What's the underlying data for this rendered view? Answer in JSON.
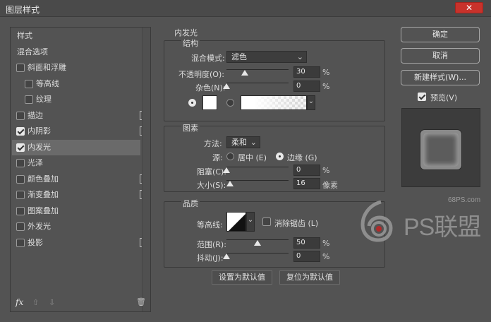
{
  "window": {
    "title": "图层样式",
    "close_glyph": "✕"
  },
  "sidebar": {
    "items": [
      {
        "label": "样式",
        "checkbox": false,
        "checked": false,
        "plus": false,
        "indent": 0,
        "selected": false
      },
      {
        "label": "混合选项",
        "checkbox": false,
        "checked": false,
        "plus": false,
        "indent": 0,
        "selected": false
      },
      {
        "label": "斜面和浮雕",
        "checkbox": true,
        "checked": false,
        "plus": false,
        "indent": 0,
        "selected": false
      },
      {
        "label": "等高线",
        "checkbox": true,
        "checked": false,
        "plus": false,
        "indent": 1,
        "selected": false
      },
      {
        "label": "纹理",
        "checkbox": true,
        "checked": false,
        "plus": false,
        "indent": 1,
        "selected": false
      },
      {
        "label": "描边",
        "checkbox": true,
        "checked": false,
        "plus": true,
        "indent": 0,
        "selected": false
      },
      {
        "label": "内阴影",
        "checkbox": true,
        "checked": true,
        "plus": true,
        "indent": 0,
        "selected": false
      },
      {
        "label": "内发光",
        "checkbox": true,
        "checked": true,
        "plus": false,
        "indent": 0,
        "selected": true
      },
      {
        "label": "光泽",
        "checkbox": true,
        "checked": false,
        "plus": false,
        "indent": 0,
        "selected": false
      },
      {
        "label": "颜色叠加",
        "checkbox": true,
        "checked": false,
        "plus": true,
        "indent": 0,
        "selected": false
      },
      {
        "label": "渐变叠加",
        "checkbox": true,
        "checked": false,
        "plus": true,
        "indent": 0,
        "selected": false
      },
      {
        "label": "图案叠加",
        "checkbox": true,
        "checked": false,
        "plus": false,
        "indent": 0,
        "selected": false
      },
      {
        "label": "外发光",
        "checkbox": true,
        "checked": false,
        "plus": false,
        "indent": 0,
        "selected": false
      },
      {
        "label": "投影",
        "checkbox": true,
        "checked": false,
        "plus": true,
        "indent": 0,
        "selected": false
      }
    ],
    "plus_glyph": "+",
    "fx_label": "fx",
    "up_glyph": "⇧",
    "down_glyph": "⇩",
    "trash_glyph": "🗑"
  },
  "inner_glow": {
    "title": "内发光",
    "structure": {
      "title": "结构",
      "blend_label": "混合模式:",
      "blend_value": "滤色",
      "opacity_label": "不透明度(O):",
      "opacity_value": "30",
      "opacity_level": 0.3,
      "noise_label": "杂色(N):",
      "noise_value": "0",
      "noise_level": 0,
      "pct": "%"
    },
    "elements": {
      "title": "图素",
      "method_label": "方法:",
      "method_value": "柔和",
      "source_label": "源:",
      "center_label": "居中 (E)",
      "edge_label": "边缘 (G)",
      "source_selected": "edge",
      "choke_label": "阻塞(C):",
      "choke_value": "0",
      "choke_level": 0,
      "size_label": "大小(S):",
      "size_value": "16",
      "size_level": 0.06,
      "size_unit": "像素",
      "pct": "%"
    },
    "quality": {
      "title": "品质",
      "contour_label": "等高线:",
      "antialias_label": "消除锯齿 (L)",
      "antialias_checked": false,
      "range_label": "范围(R):",
      "range_value": "50",
      "range_level": 0.5,
      "jitter_label": "抖动(J):",
      "jitter_value": "0",
      "jitter_level": 0,
      "pct": "%"
    },
    "set_default": "设置为默认值",
    "reset_default": "复位为默认值",
    "chevron": "⌄"
  },
  "buttons": {
    "ok": "确定",
    "cancel": "取消",
    "new_style": "新建样式(W)...",
    "preview_label": "预览(V)",
    "preview_checked": true
  },
  "watermark": {
    "site": "68PS.com",
    "brand": "PS联盟"
  }
}
